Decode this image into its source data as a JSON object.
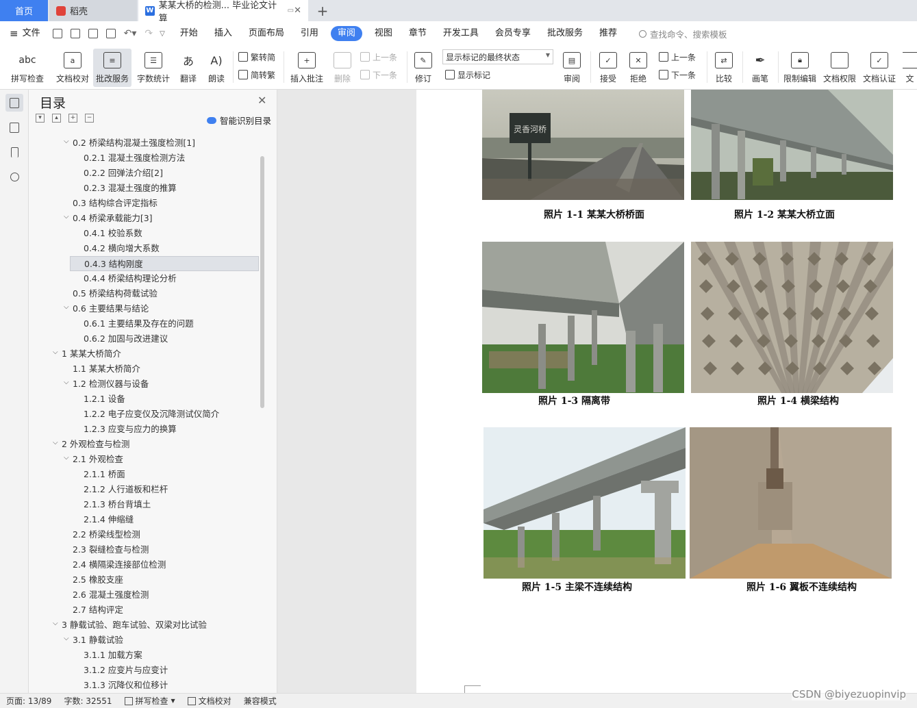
{
  "tabs": {
    "home": "首页",
    "doc1": "稻壳",
    "doc2": "某某大桥的检测... 毕业论文计算",
    "new_tab": "+"
  },
  "menu": {
    "file": "文件",
    "items": [
      "开始",
      "插入",
      "页面布局",
      "引用",
      "审阅",
      "视图",
      "章节",
      "开发工具",
      "会员专享",
      "批改服务",
      "推荐"
    ],
    "active": "审阅",
    "search_placeholder": "查找命令、搜索模板"
  },
  "ribbon": {
    "spellcheck": "拼写检查",
    "doc_proof": "文档校对",
    "review_service": "批改服务",
    "word_count": "字数统计",
    "translate": "翻译",
    "read_aloud": "朗读",
    "to_traditional": "繁转简",
    "to_simplified": "简转繁",
    "insert_comment": "插入批注",
    "delete": "删除",
    "prev": "上一条",
    "next": "下一条",
    "track_changes": "修订",
    "markup_state": "显示标记的最终状态",
    "show_markup": "显示标记",
    "review": "审阅",
    "accept": "接受",
    "reject": "拒绝",
    "prev2": "上一条",
    "next2": "下一条",
    "compare": "比较",
    "ink": "画笔",
    "restrict": "限制编辑",
    "permission": "文档权限",
    "certify": "文档认证",
    "more": "文"
  },
  "panel": {
    "title": "目录",
    "smart_toc": "智能识别目录",
    "toc": [
      {
        "label": "0.2  桥梁结构混凝土强度检测[1]",
        "level": 2,
        "arrow": true
      },
      {
        "label": "0.2.1  混凝土强度检测方法",
        "level": 3
      },
      {
        "label": "0.2.2  回弹法介绍[2]",
        "level": 3
      },
      {
        "label": "0.2.3  混凝土强度的推算",
        "level": 3
      },
      {
        "label": "0.3  结构综合评定指标",
        "level": 2
      },
      {
        "label": "0.4 桥梁承载能力[3]",
        "level": 2,
        "arrow": true
      },
      {
        "label": "0.4.1  校验系数",
        "level": 3
      },
      {
        "label": "0.4.2  横向增大系数",
        "level": 3
      },
      {
        "label": "0.4.3  结构刚度",
        "level": 3,
        "selected": true
      },
      {
        "label": "0.4.4  桥梁结构理论分析",
        "level": 3
      },
      {
        "label": "0.5  桥梁结构荷载试验",
        "level": 2
      },
      {
        "label": "0.6  主要结果与结论",
        "level": 2,
        "arrow": true
      },
      {
        "label": "0.6.1  主要结果及存在的问题",
        "level": 3
      },
      {
        "label": "0.6.2  加固与改进建议",
        "level": 3
      },
      {
        "label": "1 某某大桥简介",
        "level": 1,
        "arrow": true
      },
      {
        "label": "1.1 某某大桥简介",
        "level": 2
      },
      {
        "label": "1.2  检测仪器与设备",
        "level": 2,
        "arrow": true
      },
      {
        "label": "1.2.1 设备",
        "level": 3
      },
      {
        "label": "1.2.2 电子应变仪及沉降测试仪简介",
        "level": 3
      },
      {
        "label": "1.2.3  应变与应力的换算",
        "level": 3
      },
      {
        "label": "2  外观检查与检测",
        "level": 1,
        "arrow": true
      },
      {
        "label": "2.1 外观检查",
        "level": 2,
        "arrow": true
      },
      {
        "label": "2.1.1 桥面",
        "level": 3
      },
      {
        "label": "2.1.2 人行道板和栏杆",
        "level": 3
      },
      {
        "label": "2.1.3 桥台背填土",
        "level": 3
      },
      {
        "label": "2.1.4 伸缩缝",
        "level": 3
      },
      {
        "label": "2.2  桥梁线型检测",
        "level": 2
      },
      {
        "label": "2.3  裂缝检查与检测",
        "level": 2
      },
      {
        "label": "2.4  横隔梁连接部位检测",
        "level": 2
      },
      {
        "label": "2.5  橡胶支座",
        "level": 2
      },
      {
        "label": "2.6  混凝土强度检测",
        "level": 2
      },
      {
        "label": "2.7  结构评定",
        "level": 2
      },
      {
        "label": "3  静载试验、跑车试验、双梁对比试验",
        "level": 1,
        "arrow": true
      },
      {
        "label": "3.1 静载试验",
        "level": 2,
        "arrow": true
      },
      {
        "label": "3.1.1 加载方案",
        "level": 3
      },
      {
        "label": "3.1.2  应变片与应变计",
        "level": 3
      },
      {
        "label": "3.1.3 沉降仪和位移计",
        "level": 3
      }
    ]
  },
  "document": {
    "captions": [
      "照片 1-1 某某大桥桥面",
      "照片 1-2  某某大桥立面",
      "照片 1-3 隔离带",
      "照片 1-4  横梁结构",
      "照片 1-5 主梁不连续结构",
      "照片 1-6  翼板不连续结构"
    ],
    "sign_text": "灵香河桥"
  },
  "status": {
    "page": "页面: 13/89",
    "words": "字数: 32551",
    "spell": "拼写检查",
    "proof": "文档校对",
    "compat": "兼容模式"
  },
  "watermark": "CSDN @biyezuopinvip"
}
